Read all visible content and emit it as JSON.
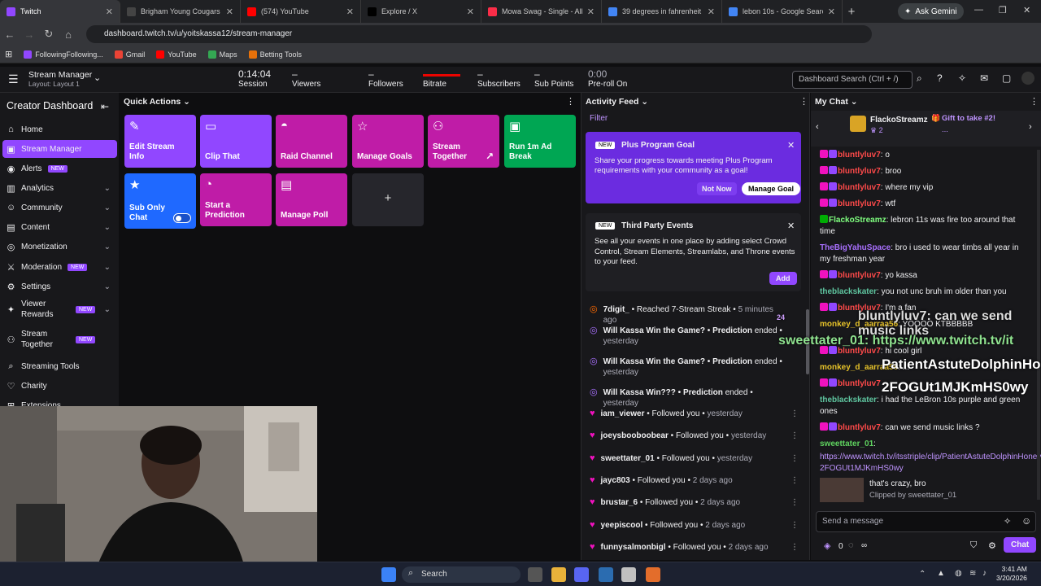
{
  "browser": {
    "tabs": [
      {
        "title": "Twitch",
        "color": "#9147ff"
      },
      {
        "title": "Brigham Young Cougars vs T",
        "color": "#444"
      },
      {
        "title": "(574) YouTube",
        "color": "#ff0000"
      },
      {
        "title": "Explore / X",
        "color": "#000"
      },
      {
        "title": "Mowa Swag - Single - Album",
        "color": "#fa2d48"
      },
      {
        "title": "39 degrees in fahrenheit to c",
        "color": "#4285f4"
      },
      {
        "title": "lebon 10s - Google Search",
        "color": "#4285f4"
      }
    ],
    "new_tab": "+",
    "gemini": "Ask Gemini",
    "url": "dashboard.twitch.tv/u/yoitskassa12/stream-manager",
    "profile": "Lu",
    "bookmarks": [
      {
        "label": "FollowingFollowing...",
        "color": "#9147ff"
      },
      {
        "label": "Gmail",
        "color": "#ea4335"
      },
      {
        "label": "YouTube",
        "color": "#ff0000"
      },
      {
        "label": "Maps",
        "color": "#34a853"
      },
      {
        "label": "Betting Tools",
        "color": "#e8710a"
      }
    ]
  },
  "topbar": {
    "title": "Stream Manager",
    "layout": "Layout: Layout 1",
    "stats": [
      {
        "value": "0:14:04",
        "label": "Session"
      },
      {
        "value": "–",
        "label": "Viewers"
      },
      {
        "value": "–",
        "label": "Followers"
      },
      {
        "value": "",
        "label": "Bitrate"
      },
      {
        "value": "–",
        "label": "Subscribers"
      },
      {
        "value": "–",
        "label": "Sub Points"
      },
      {
        "value": "0:00",
        "label": "Pre-roll On"
      }
    ],
    "search_placeholder": "Dashboard Search (Ctrl + /)"
  },
  "sidebar": {
    "title": "Creator Dashboard",
    "items": [
      {
        "label": "Home",
        "icon": "home-icon",
        "glyph": "⌂"
      },
      {
        "label": "Stream Manager",
        "icon": "stream-icon",
        "glyph": "▣"
      },
      {
        "label": "Alerts",
        "icon": "alerts-icon",
        "glyph": "◉",
        "badge": "NEW"
      },
      {
        "label": "Analytics",
        "icon": "analytics-icon",
        "glyph": "▥",
        "chev": "⌄"
      },
      {
        "label": "Community",
        "icon": "community-icon",
        "glyph": "☺",
        "chev": "⌄"
      },
      {
        "label": "Content",
        "icon": "content-icon",
        "glyph": "▤",
        "chev": "⌄"
      },
      {
        "label": "Monetization",
        "icon": "monetization-icon",
        "glyph": "◎",
        "chev": "⌄"
      },
      {
        "label": "Moderation",
        "icon": "sword-icon",
        "glyph": "⚔",
        "badge": "NEW",
        "chev": "⌄"
      },
      {
        "label": "Settings",
        "icon": "gear-icon",
        "glyph": "⚙",
        "chev": "⌄"
      },
      {
        "label": "Viewer Rewards",
        "icon": "rewards-icon",
        "glyph": "✦",
        "badge": "NEW",
        "chev": "⌄"
      },
      {
        "label": "Stream Together",
        "icon": "together-icon",
        "glyph": "⚇",
        "badge": "NEW"
      },
      {
        "label": "Streaming Tools",
        "icon": "tools-icon",
        "glyph": "⌕"
      },
      {
        "label": "Charity",
        "icon": "charity-icon",
        "glyph": "♡"
      },
      {
        "label": "Extensions",
        "icon": "extensions-icon",
        "glyph": "⊞"
      }
    ]
  },
  "quick_actions": {
    "title": "Quick Actions",
    "tiles": [
      {
        "label": "Edit Stream Info",
        "color": "#9147ff",
        "glyph": "✎"
      },
      {
        "label": "Clip That",
        "color": "#9147ff",
        "glyph": "▭"
      },
      {
        "label": "Raid Channel",
        "color": "#bf1ca7",
        "glyph": "◓"
      },
      {
        "label": "Manage Goals",
        "color": "#bf1ca7",
        "glyph": "☆"
      },
      {
        "label": "Stream Together",
        "color": "#bf1ca7",
        "glyph": "⚇",
        "arrow": "↗"
      },
      {
        "label": "Run 1m Ad Break",
        "color": "#00a653",
        "glyph": "▣"
      },
      {
        "label": "Sub Only Chat",
        "color": "#1f69ff",
        "glyph": "★",
        "toggle": true
      },
      {
        "label": "Start a Prediction",
        "color": "#bf1ca7",
        "glyph": "◔"
      },
      {
        "label": "Manage Poll",
        "color": "#bf1ca7",
        "glyph": "▤"
      },
      {
        "label": "+",
        "color": "#26262c",
        "glyph": ""
      }
    ]
  },
  "activity_feed": {
    "title": "Activity Feed",
    "filter": "Filter",
    "goal_card": {
      "badge": "NEW",
      "title": "Plus Program Goal",
      "text": "Share your progress towards meeting Plus Program requirements with your community as a goal!",
      "not_now": "Not Now",
      "manage": "Manage Goal"
    },
    "third_party": {
      "badge": "NEW",
      "title": "Third Party Events",
      "text": "See all your events in one place by adding select Crowd Control, Stream Elements, Streamlabs, and Throne events to your feed.",
      "add": "Add"
    },
    "events": [
      {
        "icon": "streak",
        "user": "7digit_",
        "action": "• Reached 7-Stream Streak •",
        "time": "5 minutes ago"
      },
      {
        "icon": "prediction",
        "user": "Will Kassa Win the Game? • Prediction",
        "action": "ended •",
        "time": "yesterday"
      },
      {
        "icon": "prediction",
        "user": "Will Kassa Win the Game? • Prediction",
        "action": "ended •",
        "time": "yesterday"
      },
      {
        "icon": "prediction",
        "user": "Will Kassa Win??? • Prediction",
        "action": "ended •",
        "time": "yesterday"
      },
      {
        "icon": "follow",
        "user": "iam_viewer",
        "action": "• Followed you •",
        "time": "yesterday"
      },
      {
        "icon": "follow",
        "user": "joeysbooboobear",
        "action": "• Followed you •",
        "time": "yesterday"
      },
      {
        "icon": "follow",
        "user": "sweettater_01",
        "action": "• Followed you •",
        "time": "yesterday"
      },
      {
        "icon": "follow",
        "user": "jayc803",
        "action": "• Followed you •",
        "time": "2 days ago"
      },
      {
        "icon": "follow",
        "user": "brustar_6",
        "action": "• Followed you •",
        "time": "2 days ago"
      },
      {
        "icon": "follow",
        "user": "yeepiscool",
        "action": "• Followed you •",
        "time": "2 days ago"
      },
      {
        "icon": "follow",
        "user": "funnysalmonbigl",
        "action": "• Followed you •",
        "time": "2 days ago"
      }
    ]
  },
  "chat": {
    "title": "My Chat",
    "pinned": {
      "user": "FlackoStreamz",
      "count": "2",
      "gift": "Gift to take #2!",
      "more": "..."
    },
    "messages": [
      {
        "user": "bluntlyluv7",
        "color": "#ff4a4a",
        "text": ": o"
      },
      {
        "user": "bluntlyluv7",
        "color": "#ff4a4a",
        "text": ": broo"
      },
      {
        "user": "bluntlyluv7",
        "color": "#ff4a4a",
        "text": ": where my vip"
      },
      {
        "user": "bluntlyluv7",
        "color": "#ff4a4a",
        "text": ": wtf"
      },
      {
        "user": "FlackoStreamz",
        "color": "#7fff7f",
        "text": ": lebron 11s was fire too around that time"
      },
      {
        "user": "TheBigYahuSpace",
        "color": "#a970ff",
        "text": ": bro i used to wear timbs all year in my freshman year"
      },
      {
        "user": "bluntlyluv7",
        "color": "#ff4a4a",
        "text": ": yo kassa"
      },
      {
        "user": "theblackskater",
        "color": "#5fc6a0",
        "text": ": you not unc bruh im older than you"
      },
      {
        "user": "bluntlyluv7",
        "color": "#ff4a4a",
        "text": ": I'm a fan"
      },
      {
        "user": "monkey_d_aarraa56",
        "color": "#e6c229",
        "text": ": YOOOO KTBBBBB"
      },
      {
        "user": "bluntlyluv7",
        "color": "#ff4a4a",
        "text": ": hi cool girl"
      },
      {
        "user": "monkey_d_aarraa56",
        "color": "#e6c229",
        "text": ": ..."
      },
      {
        "user": "bluntlyluv7",
        "color": "#ff4a4a",
        "text": ""
      },
      {
        "user": "theblackskater",
        "color": "#5fc6a0",
        "text": ": i had the LeBron 10s purple and green ones"
      },
      {
        "user": "bluntlyluv7",
        "color": "#ff4a4a",
        "text": ": can we send music links ?"
      },
      {
        "user": "sweettater_01",
        "color": "#5fd35f",
        "text": ":"
      }
    ],
    "link": "https://www.twitch.tv/itsstriple/clip/PatientAstuteDolphinHoneyBadger-2FOGUt1MJKmHS0wy",
    "clip_title": "that's crazy, bro",
    "clip_by": "Clipped by sweettater_01",
    "input_placeholder": "Send a message",
    "points": "0",
    "infinity": "∞",
    "chat_button": "Chat"
  },
  "overlay": {
    "line1": "bluntlyluv7: can we send music links",
    "line2": "sweettater_01: https://www.twitch.tv/it",
    "line3": "PatientAstuteDolphinHo",
    "line4": "2FOGUt1MJKmHS0wy",
    "count": "24"
  },
  "taskbar": {
    "search": "Search",
    "time": "3:41 AM",
    "date": "3/20/2026"
  }
}
